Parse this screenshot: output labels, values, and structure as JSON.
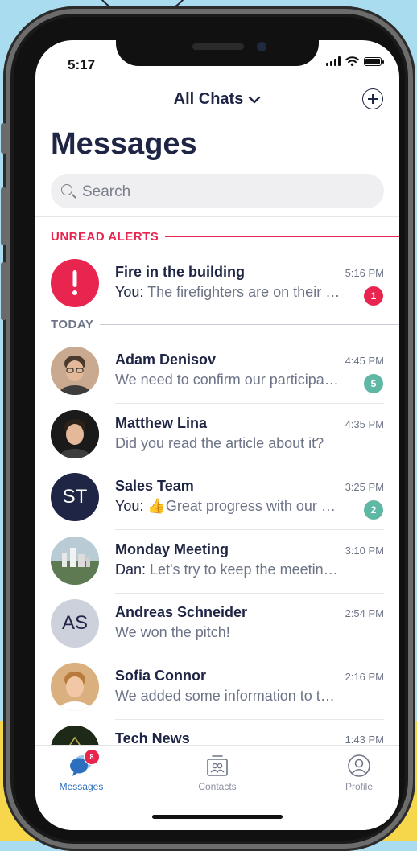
{
  "status": {
    "time": "5:17"
  },
  "header": {
    "title": "All Chats",
    "page_title": "Messages"
  },
  "search": {
    "placeholder": "Search"
  },
  "sections": {
    "unread": "UNREAD ALERTS",
    "today": "TODAY"
  },
  "colors": {
    "alert": "#e8254f",
    "teal": "#5fb8a4",
    "navy": "#1f2544",
    "gray": "#8a8fa0"
  },
  "alert_chat": {
    "name": "Fire in the building",
    "sender": "You:",
    "message": "The firefighters are on their way",
    "time": "5:16 PM",
    "badge": "1",
    "icon": "exclamation-icon"
  },
  "chats": [
    {
      "name": "Adam Denisov",
      "sender": "",
      "message": "We need to confirm our participation",
      "time": "4:45 PM",
      "badge": "5",
      "avatar": "photo",
      "initials": ""
    },
    {
      "name": "Matthew Lina",
      "sender": "",
      "message": "Did you read the article about it?",
      "time": "4:35 PM",
      "badge": "",
      "avatar": "photo",
      "initials": ""
    },
    {
      "name": "Sales Team",
      "sender": "You:",
      "message": "👍Great progress with our clients",
      "time": "3:25 PM",
      "badge": "2",
      "avatar": "initials",
      "initials": "ST"
    },
    {
      "name": "Monday Meeting",
      "sender": "Dan:",
      "message": "Let's try to keep the meeting short",
      "time": "3:10 PM",
      "badge": "",
      "avatar": "photo",
      "initials": ""
    },
    {
      "name": "Andreas Schneider",
      "sender": "",
      "message": "We won the pitch!",
      "time": "2:54 PM",
      "badge": "",
      "avatar": "initials",
      "initials": "AS"
    },
    {
      "name": "Sofia Connor",
      "sender": "",
      "message": "We added some information to the doc",
      "time": "2:16 PM",
      "badge": "",
      "avatar": "photo",
      "initials": ""
    },
    {
      "name": "Tech News",
      "sender": "",
      "message": "",
      "time": "1:43 PM",
      "badge": "",
      "avatar": "photo",
      "initials": ""
    }
  ],
  "tabs": [
    {
      "label": "Messages",
      "icon": "chat-bubbles-icon",
      "badge": "8",
      "active": true
    },
    {
      "label": "Contacts",
      "icon": "contacts-icon",
      "badge": "",
      "active": false
    },
    {
      "label": "Profile",
      "icon": "profile-icon",
      "badge": "",
      "active": false
    }
  ]
}
